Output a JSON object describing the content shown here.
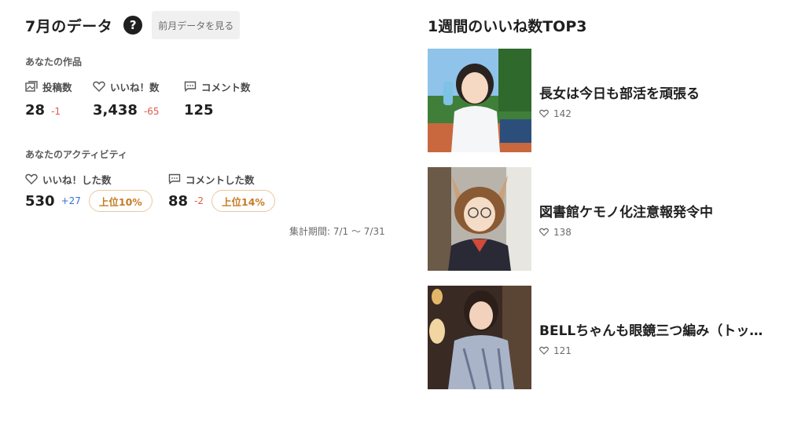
{
  "header": {
    "title": "7月のデータ",
    "help_glyph": "?",
    "prev_button": "前月データを見る"
  },
  "your_works": {
    "label": "あなたの作品",
    "posts": {
      "label": "投稿数",
      "value": "28",
      "diff": "-1"
    },
    "likes": {
      "label": "いいね！数",
      "value": "3,438",
      "diff": "-65"
    },
    "comments": {
      "label": "コメント数",
      "value": "125"
    }
  },
  "your_activity": {
    "label": "あなたのアクティビティ",
    "likes_given": {
      "label": "いいね！した数",
      "value": "530",
      "diff": "+27",
      "rank": "上位10%"
    },
    "comments_given": {
      "label": "コメントした数",
      "value": "88",
      "diff": "-2",
      "rank": "上位14%"
    }
  },
  "period": "集計期間: 7/1 〜 7/31",
  "top3": {
    "title": "1週間のいいね数TOP3",
    "items": [
      {
        "title": "長女は今日も部活を頑張る",
        "likes": "142"
      },
      {
        "title": "図書館ケモノ化注意報発令中",
        "likes": "138"
      },
      {
        "title": "BELLちゃんも眼鏡三つ編み（トッ…",
        "likes": "121"
      }
    ]
  },
  "colors": {
    "negative": "#e05a4a",
    "positive": "#3a6fd6",
    "rank_badge": "#c57c25"
  }
}
